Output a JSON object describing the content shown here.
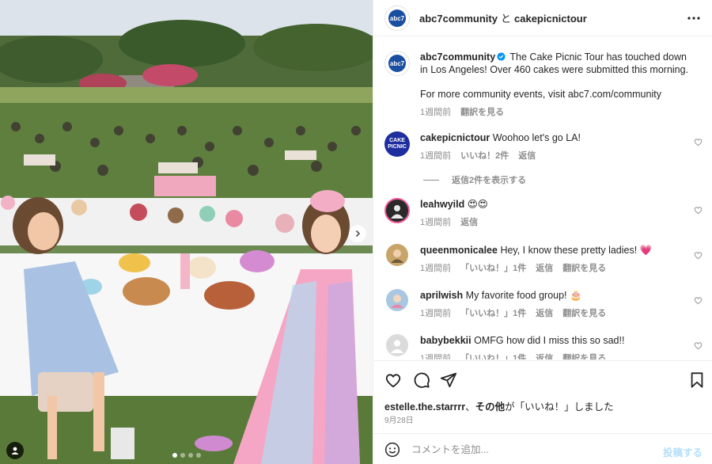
{
  "header": {
    "author": "abc7community",
    "conjunction": "と",
    "collaborator": "cakepicnictour",
    "more_icon": "more-horizontal-icon"
  },
  "caption": {
    "username": "abc7community",
    "line1": "The Cake Picnic Tour has touched down in Los Angeles! Over 460 cakes were submitted this morning.",
    "line2": "For more community events, visit abc7.com/community",
    "time": "1週間前",
    "translate": "翻訳を見る"
  },
  "comments": [
    {
      "username": "cakepicnictour",
      "text": "Woohoo let's go LA!",
      "time": "1週間前",
      "likes": "いいね！2件",
      "reply": "返信",
      "translate": "",
      "avatar_text": "CAKE PICNIC",
      "view_replies": "返信2件を表示する"
    },
    {
      "username": "leahwyild",
      "text": "😍😍",
      "time": "1週間前",
      "likes": "",
      "reply": "返信",
      "translate": ""
    },
    {
      "username": "queenmonicalee",
      "text": "Hey, I know these pretty ladies! 💗",
      "time": "1週間前",
      "likes": "「いいね！」1件",
      "reply": "返信",
      "translate": "翻訳を見る"
    },
    {
      "username": "aprilwish",
      "text": "My favorite food group! 🎂",
      "time": "1週間前",
      "likes": "「いいね！」1件",
      "reply": "返信",
      "translate": "翻訳を見る"
    },
    {
      "username": "babybekkii",
      "text": "OMFG how did I miss this so sad!!",
      "time": "1週間前",
      "likes": "「いいね！」1件",
      "reply": "返信",
      "translate": "翻訳を見る"
    }
  ],
  "actions": {
    "like_icon": "heart-icon",
    "comment_icon": "comment-icon",
    "share_icon": "send-icon",
    "save_icon": "bookmark-icon"
  },
  "liked_by": {
    "user": "estelle.the.starrrr",
    "separator": "、",
    "others": "その他",
    "suffix": "が「いいね！」しました"
  },
  "post_date": "9月28日",
  "composer": {
    "placeholder": "コメントを追加...",
    "post_label": "投稿する"
  },
  "carousel": {
    "slide_count": 4,
    "active_slide": 1
  },
  "colors": {
    "accent_blue": "#b2dffc",
    "verified_blue": "#0095f6",
    "cake_brand": "#1f2e9f"
  }
}
